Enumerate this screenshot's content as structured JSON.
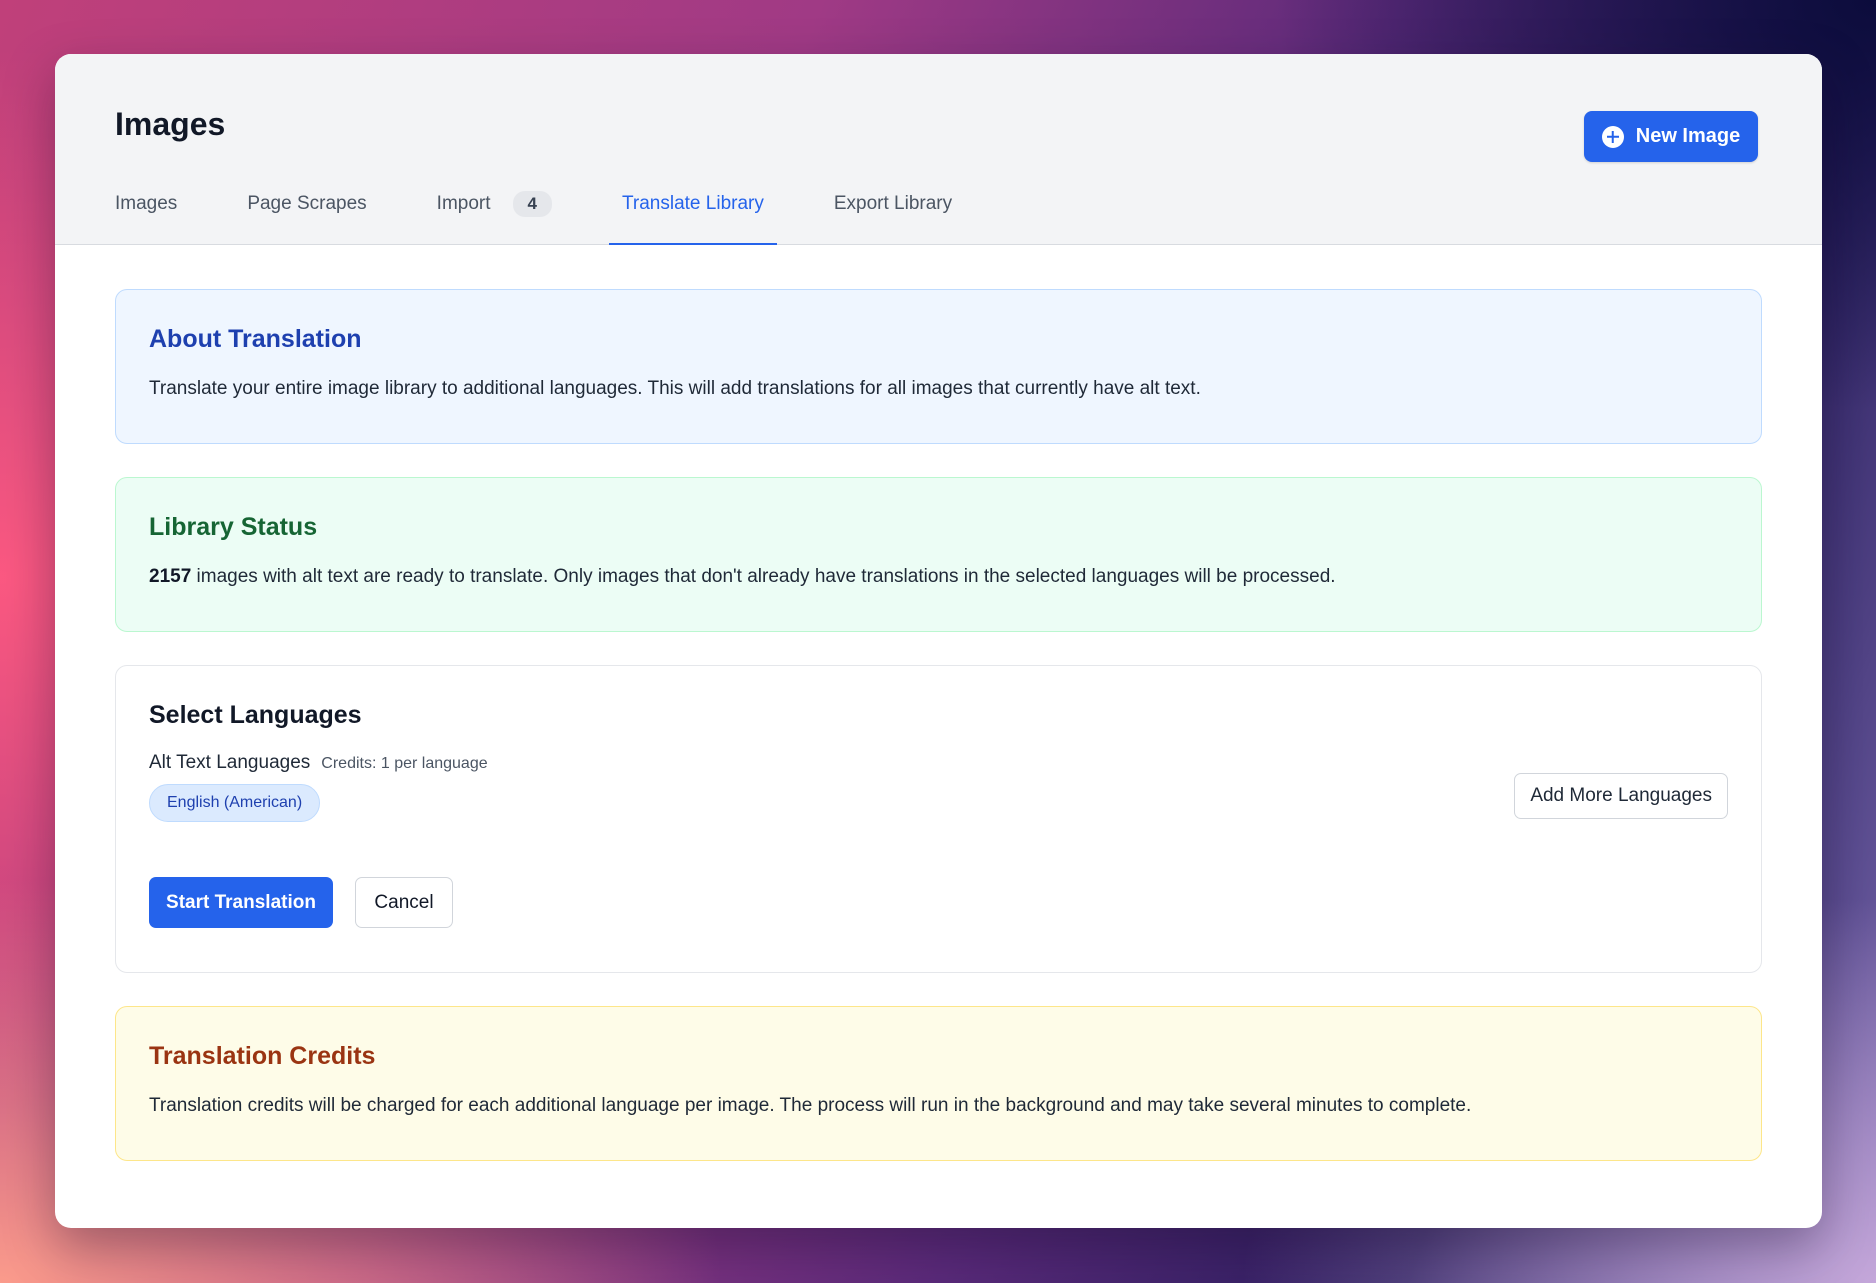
{
  "header": {
    "title": "Images",
    "new_button_label": "New Image"
  },
  "tabs": [
    {
      "label": "Images",
      "active": false
    },
    {
      "label": "Page Scrapes",
      "active": false
    },
    {
      "label": "Import",
      "badge": "4",
      "active": false
    },
    {
      "label": "Translate Library",
      "active": true
    },
    {
      "label": "Export Library",
      "active": false
    }
  ],
  "about": {
    "title": "About Translation",
    "text": "Translate your entire image library to additional languages. This will add translations for all images that currently have alt text."
  },
  "status": {
    "title": "Library Status",
    "count": "2157",
    "text": " images with alt text are ready to translate. Only images that don't already have translations in the selected languages will be processed."
  },
  "languages": {
    "title": "Select Languages",
    "field_label": "Alt Text Languages",
    "credits_note": "Credits: 1 per language",
    "selected": [
      "English (American)"
    ],
    "add_button_label": "Add More Languages",
    "start_button_label": "Start Translation",
    "cancel_button_label": "Cancel"
  },
  "credits": {
    "title": "Translation Credits",
    "text": "Translation credits will be charged for each additional language per image. The process will run in the background and may take several minutes to complete."
  },
  "colors": {
    "accent": "#2563eb",
    "about_bg": "#eff6ff",
    "status_bg": "#ecfdf5",
    "credits_bg": "#fefce8"
  }
}
